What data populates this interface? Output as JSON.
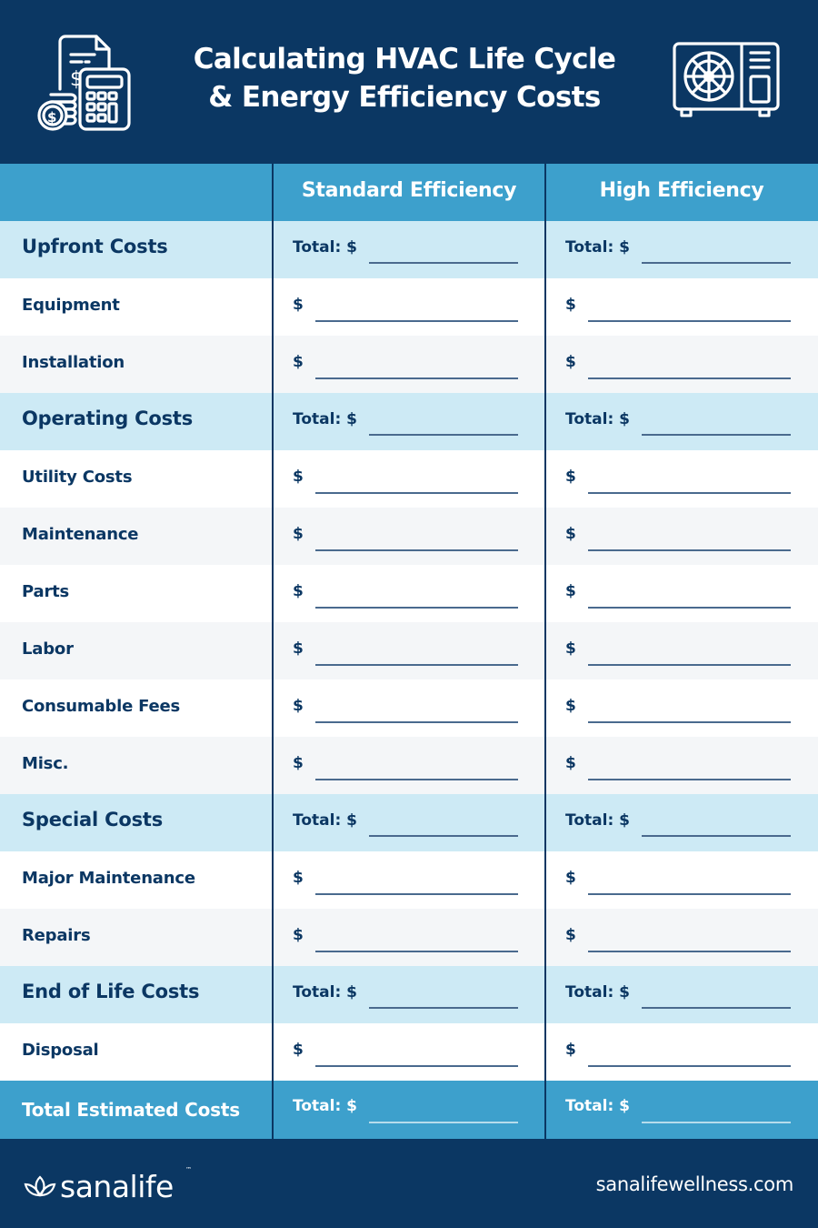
{
  "header": {
    "title_line1": "Calculating HVAC Life Cycle",
    "title_line2": "& Energy Efficiency Costs",
    "icon_left": "calculator-invoice-coins-icon",
    "icon_right": "hvac-outdoor-unit-icon"
  },
  "colors": {
    "navy": "#0b3763",
    "header_blue": "#3da0cc",
    "section_light_blue": "#cdeaf5",
    "row_grey": "#f4f6f8",
    "white": "#ffffff"
  },
  "table": {
    "columns": [
      "",
      "Standard Efficiency",
      "High Efficiency"
    ],
    "rows": [
      {
        "type": "section",
        "label": "Upfront Costs",
        "prefix": "Total: $"
      },
      {
        "type": "item",
        "label": "Equipment",
        "prefix": "$"
      },
      {
        "type": "item",
        "label": "Installation",
        "prefix": "$"
      },
      {
        "type": "section",
        "label": "Operating Costs",
        "prefix": "Total: $"
      },
      {
        "type": "item",
        "label": "Utility Costs",
        "prefix": "$"
      },
      {
        "type": "item",
        "label": "Maintenance",
        "prefix": "$"
      },
      {
        "type": "item",
        "label": "Parts",
        "prefix": "$"
      },
      {
        "type": "item",
        "label": "Labor",
        "prefix": "$"
      },
      {
        "type": "item",
        "label": "Consumable Fees",
        "prefix": "$"
      },
      {
        "type": "item",
        "label": "Misc.",
        "prefix": "$"
      },
      {
        "type": "section",
        "label": "Special Costs",
        "prefix": "Total: $"
      },
      {
        "type": "item",
        "label": "Major Maintenance",
        "prefix": "$"
      },
      {
        "type": "item",
        "label": "Repairs",
        "prefix": "$"
      },
      {
        "type": "section",
        "label": "End of Life Costs",
        "prefix": "Total: $"
      },
      {
        "type": "item",
        "label": "Disposal",
        "prefix": "$"
      },
      {
        "type": "total",
        "label": "Total Estimated Costs",
        "prefix": "Total: $"
      }
    ]
  },
  "footer": {
    "brand": "sanalife",
    "trademark": "™",
    "website": "sanalifewellness.com",
    "logo_icon": "lotus-icon"
  }
}
